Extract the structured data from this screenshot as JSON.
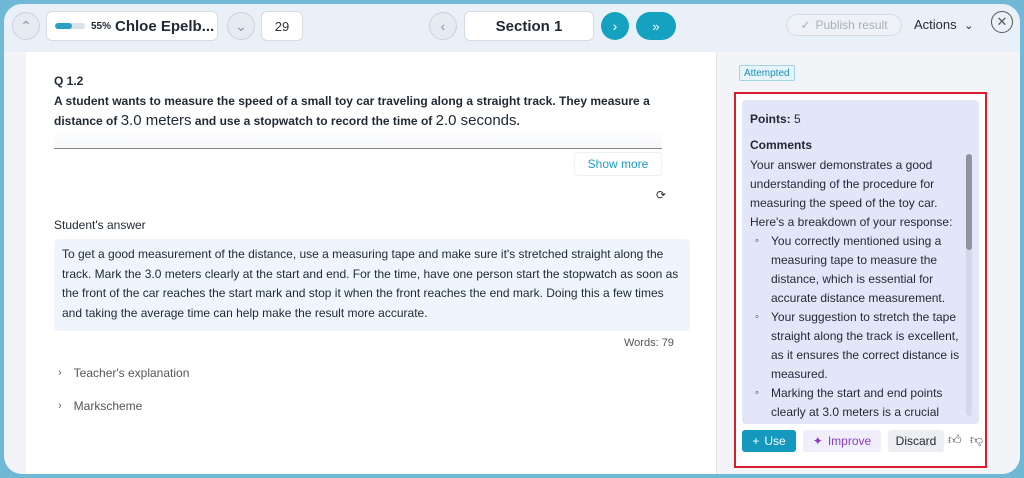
{
  "header": {
    "progress_percent_label": "55%",
    "progress_fraction": 0.55,
    "student_name": "Chloe Epelb...",
    "question_number": "29",
    "section_title": "Section 1",
    "publish_label": "Publish result",
    "actions_label": "Actions",
    "icons": {
      "up": "chevron-up-icon",
      "down": "chevron-down-icon",
      "prev": "chevron-left-icon",
      "next": "chevron-right-icon",
      "last": "double-chevron-right-icon",
      "close": "close-icon"
    }
  },
  "question": {
    "number": "Q 1.2",
    "text_part1": "A student wants to measure the speed of a small toy car traveling along a straight track. They measure a distance of ",
    "distance_value": "3.0 meters",
    "text_part2": " and use a stopwatch to record the time of ",
    "time_value": "2.0 seconds",
    "text_part3": ".",
    "show_more_label": "Show more"
  },
  "answer": {
    "label": "Student's answer",
    "text": "To get a good measurement of the distance, use a measuring tape and make sure it's stretched straight along the track. Mark the 3.0 meters clearly at the start and end. For the time, have one person start the stopwatch as soon as the front of the car reaches the start mark and stop it when the front reaches the end mark. Doing this a few times and taking the average time can help make the result more accurate.",
    "word_count": "Words: 79"
  },
  "sections": {
    "teacher_explanation": "Teacher's explanation",
    "markscheme": "Markscheme"
  },
  "feedback": {
    "status_badge": "Attempted",
    "points_label": "Points:",
    "points_value": "5",
    "comments_title": "Comments",
    "intro": "Your answer demonstrates a good understanding of the procedure for measuring the speed of the toy car. Here's a breakdown of your response:",
    "bullets": [
      "You correctly mentioned using a measuring tape to measure the distance, which is essential for accurate distance measurement.",
      "Your suggestion to stretch the tape straight along the track is excellent, as it ensures the correct distance is measured.",
      "Marking the start and end points clearly at 3.0 meters is a crucial"
    ],
    "use_label": "Use",
    "improve_label": "Improve",
    "discard_label": "Discard"
  },
  "colors": {
    "accent": "#14a2c0",
    "highlight_border": "#d81e2a",
    "improve": "#8a3ec2"
  }
}
